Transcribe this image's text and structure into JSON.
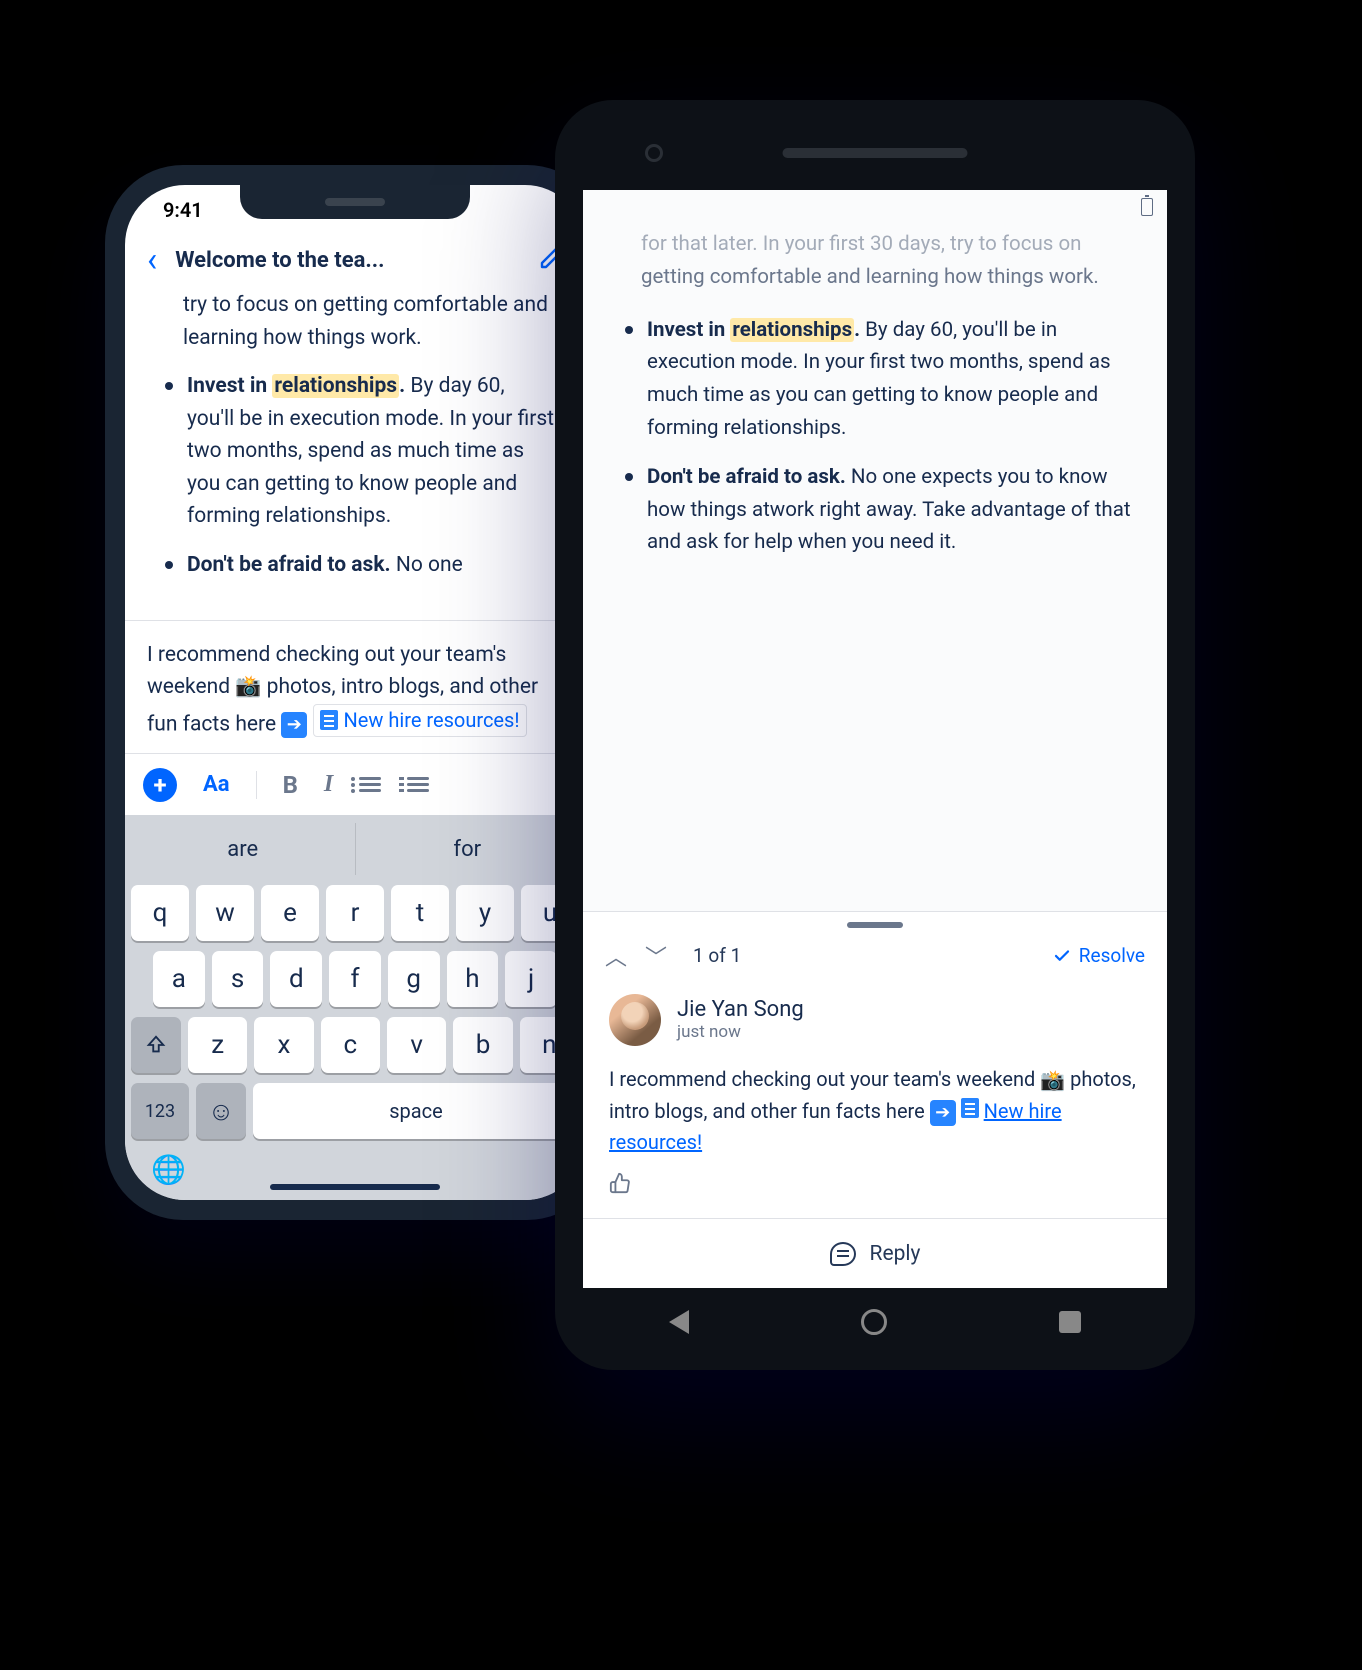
{
  "iphone": {
    "status_time": "9:41",
    "header_title": "Welcome to the tea...",
    "intro_text": "try to focus on getting comfortable and learning how things work.",
    "bullets": [
      {
        "bold_prefix": "Invest in ",
        "highlight": "relationships",
        "bold_suffix": ".",
        "rest": " By day 60, you'll be in execution mode. In your first two months, spend as much time as you can getting to know people and forming relationships."
      },
      {
        "bold_prefix": "Don't be afraid to ask.",
        "rest": " No one"
      }
    ],
    "comment_preview": {
      "line1": "I recommend checking out your team's weekend ",
      "line2": " photos, intro blogs, and other fun facts here ",
      "link_text": "New hire resources!"
    },
    "toolbar": {
      "aa": "Aa",
      "bold": "B",
      "italic": "I"
    },
    "keyboard": {
      "predict": [
        "are",
        "for"
      ],
      "row1": [
        "q",
        "w",
        "e",
        "r",
        "t",
        "y",
        "u"
      ],
      "row2": [
        "a",
        "s",
        "d",
        "f",
        "g",
        "h",
        "j"
      ],
      "row3": [
        "z",
        "x",
        "c",
        "v",
        "b",
        "n"
      ],
      "num_key": "123",
      "space_key": "space"
    }
  },
  "android": {
    "cutoff_top": "for that later. In your first 30 days, try to focus on",
    "cutoff_rest": "getting comfortable and learning how things work.",
    "bullets": [
      {
        "bold_prefix": "Invest in ",
        "highlight": "relationships",
        "bold_suffix": ".",
        "rest": " By day 60, you'll be in execution mode. In your first two months, spend as much time as you can getting to know people and forming relationships."
      },
      {
        "bold_prefix": "Don't be afraid to ask.",
        "rest": " No one expects you to know how things atwork right away. Take advantage of that and ask for help when you need it."
      }
    ],
    "panel": {
      "count": "1 of 1",
      "resolve": "Resolve"
    },
    "comment": {
      "author": "Jie Yan Song",
      "time": "just now",
      "text_a": "I recommend checking out your team's weekend ",
      "text_b": " photos, intro blogs, and other fun facts here ",
      "link_text": "New hire resources!"
    },
    "reply_label": "Reply"
  }
}
